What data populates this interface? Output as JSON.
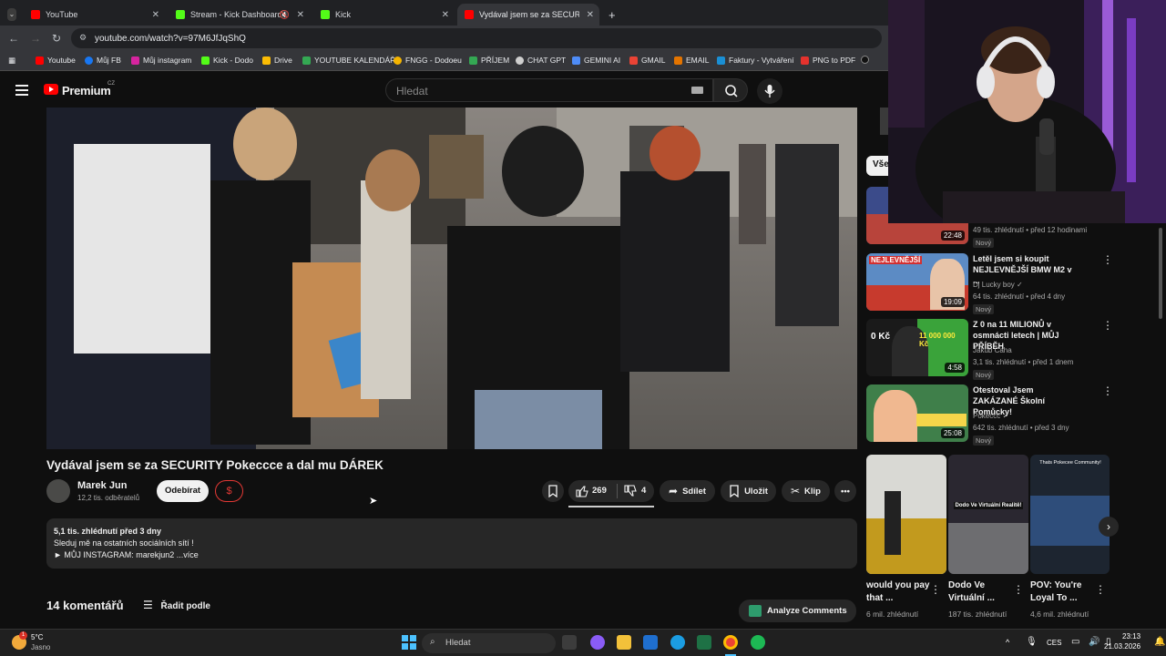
{
  "browser": {
    "tabs": [
      {
        "label": "YouTube"
      },
      {
        "label": "Stream - Kick Dashboard"
      },
      {
        "label": "Kick"
      },
      {
        "label": "Vydával jsem se za SECURITY P"
      }
    ],
    "url": "youtube.com/watch?v=97M6JfJqShQ",
    "bookmarks": [
      "Youtube",
      "Můj FB",
      "Můj instagram",
      "Kick - Dodo",
      "Drive",
      "YOUTUBE KALENDÁŘ",
      "FNGG - Dodoeu",
      "PŘÍJEM",
      "CHAT GPT",
      "GEMINI AI",
      "GMAIL",
      "EMAIL",
      "Faktury - Vytváření",
      "PNG to PDF"
    ]
  },
  "youtube": {
    "logo_text": "Premium",
    "logo_region": "CZ",
    "search_placeholder": "Hledat",
    "filter_chip": "Vše"
  },
  "video": {
    "title": "Vydával jsem se za SECURITY Pokeccce a dal mu DÁREK",
    "channel_name": "Marek Jun",
    "subscribers": "12,2 tis. odběratelů",
    "subscribe_label": "Odebírat",
    "dollar_label": "$",
    "likes": "269",
    "dislikes": "4",
    "share_label": "Sdílet",
    "save_label": "Uložit",
    "clip_label": "Klip",
    "description": {
      "stats": "5,1 tis. zhlédnutí  před 3 dny",
      "line1": "Sleduj mě na ostatních sociálních sítí !",
      "line2": "► MŮJ INSTAGRAM: marekjun2 ...více"
    },
    "comments_count": "14 komentářů",
    "sort_label": "Řadit podle",
    "analyze_label": "Analyze Comments"
  },
  "recommendations": [
    {
      "title": "",
      "channel": "",
      "meta": "49 tis. zhlédnutí  • před 12 hodinami",
      "badge": "Nový",
      "duration": "22:48"
    },
    {
      "title": "Letěl jsem si koupit NEJLEVNĚJŠÍ BMW M2 v ...",
      "channel": "Dj Lucky boy ✓",
      "meta": "64 tis. zhlédnutí  • před 4 dny",
      "badge": "Nový",
      "duration": "19:09",
      "thumb_text": "NEJLEVNĚJŠÍ"
    },
    {
      "title": "Z 0 na 11 MILIONŮ v osmnácti letech | MŮJ PŘÍBĚH",
      "channel": "Jakub Caha",
      "meta": "3,1 tis. zhlédnutí  • před 1 dnem",
      "badge": "Nový",
      "duration": "4:58",
      "thumb_text": "0 Kč",
      "thumb_text2": "11 000 000 Kč"
    },
    {
      "title": "Otestoval Jsem ZAKÁZANÉ Školní Pomůcky!",
      "channel": "Pokeccc ✓",
      "meta": "642 tis. zhlédnutí  • před 3 dny",
      "badge": "Nový",
      "duration": "25:08"
    }
  ],
  "shorts": [
    {
      "title": "would you pay that ...",
      "views": "6 mil. zhlédnutí"
    },
    {
      "title": "Dodo Ve Virtuální ...",
      "views": "187 tis. zhlédnutí",
      "thumb_text": "Dodo Ve Virtuální Realitě!"
    },
    {
      "title": "POV: You're Loyal To ...",
      "views": "4,6 mil. zhlédnutí",
      "thumb_text": "Thats Pokecee Community!"
    }
  ],
  "taskbar": {
    "weather_temp": "5°C",
    "weather_desc": "Jasno",
    "search_placeholder": "Hledat",
    "language": "CES",
    "time": "23:13",
    "date": "21.03.2026"
  },
  "colors": {
    "yt_red": "#ff0000",
    "kick_green": "#53fc18",
    "background": "#0f0f0f"
  }
}
